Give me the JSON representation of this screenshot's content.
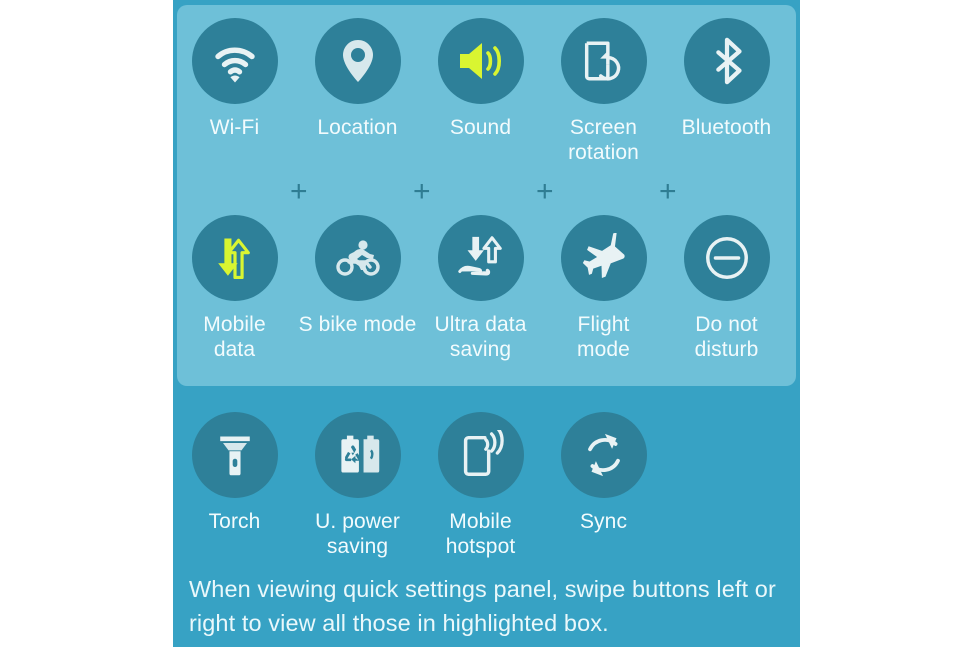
{
  "theme": {
    "page_background": "#ffffff",
    "panel_background": "#37a2c4",
    "highlight_box_background": "#6ec0d8",
    "icon_circle": "#2e8099",
    "icon_white": "#e8f2f4",
    "icon_accent": "#d9f531",
    "label_color": "#f2fbfd",
    "plus_color": "#2f7d93"
  },
  "panel": {
    "rows": [
      {
        "in_highlight_box": true,
        "tiles": [
          {
            "label": "Wi-Fi",
            "icon": "wifi-icon",
            "active": false
          },
          {
            "label": "Location",
            "icon": "location-pin-icon",
            "active": false
          },
          {
            "label": "Sound",
            "icon": "sound-speaker-icon",
            "active": true
          },
          {
            "label": "Screen\nrotation",
            "icon": "screen-rotation-icon",
            "active": false
          },
          {
            "label": "Bluetooth",
            "icon": "bluetooth-icon",
            "active": false
          }
        ]
      },
      {
        "in_highlight_box": true,
        "tiles": [
          {
            "label": "Mobile\ndata",
            "icon": "mobile-data-icon",
            "active": true
          },
          {
            "label": "S bike mode",
            "icon": "motorcycle-icon",
            "active": false
          },
          {
            "label": "Ultra data\nsaving",
            "icon": "ultra-data-saving-icon",
            "active": false
          },
          {
            "label": "Flight\nmode",
            "icon": "airplane-icon",
            "active": false
          },
          {
            "label": "Do not\ndisturb",
            "icon": "do-not-disturb-icon",
            "active": false
          }
        ]
      },
      {
        "in_highlight_box": false,
        "tiles": [
          {
            "label": "Torch",
            "icon": "flashlight-icon",
            "active": false
          },
          {
            "label": "U. power\nsaving",
            "icon": "power-saving-icon",
            "active": false
          },
          {
            "label": "Mobile\nhotspot",
            "icon": "mobile-hotspot-icon",
            "active": false
          },
          {
            "label": "Sync",
            "icon": "sync-icon",
            "active": false
          }
        ]
      }
    ],
    "separators": {
      "symbol": "+",
      "count": 4
    },
    "caption": "When viewing quick settings panel, swipe buttons left or right to view all those in highlighted box."
  }
}
